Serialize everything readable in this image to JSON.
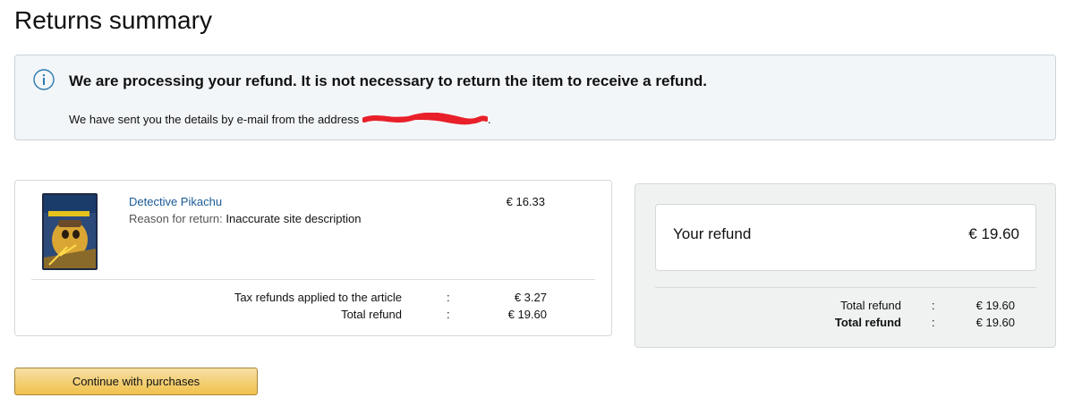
{
  "page": {
    "title": "Returns summary"
  },
  "alert": {
    "heading": "We are processing your refund. It is not necessary to return the item to receive a refund.",
    "text": "We have sent you the details by e-mail from the address",
    "email_tail": ".",
    "icon": "info-icon",
    "redaction_color": "#e8202a"
  },
  "item": {
    "title": "Detective Pikachu",
    "reason_label": "Reason for return:",
    "reason_value": "Inaccurate site description",
    "price": "€ 16.33",
    "tax_label": "Tax refunds applied to the article",
    "tax_colon": ":",
    "tax_value": "€ 3.27",
    "total_label": "Total refund",
    "total_colon": ":",
    "total_value": "€ 19.60"
  },
  "refund": {
    "label": "Your refund",
    "amount": "€ 19.60",
    "rows": [
      {
        "label": "Total refund",
        "colon": ":",
        "value": "€ 19.60"
      },
      {
        "label": "Total refund",
        "colon": ":",
        "value": "€ 19.60"
      }
    ]
  },
  "actions": {
    "continue_label": "Continue with purchases"
  },
  "colors": {
    "link": "#1a5a96",
    "button_top": "#f7dfa5",
    "button_bottom": "#f0c14b",
    "alert_bg": "#f3f6f8",
    "info_icon": "#2a7ab0"
  }
}
